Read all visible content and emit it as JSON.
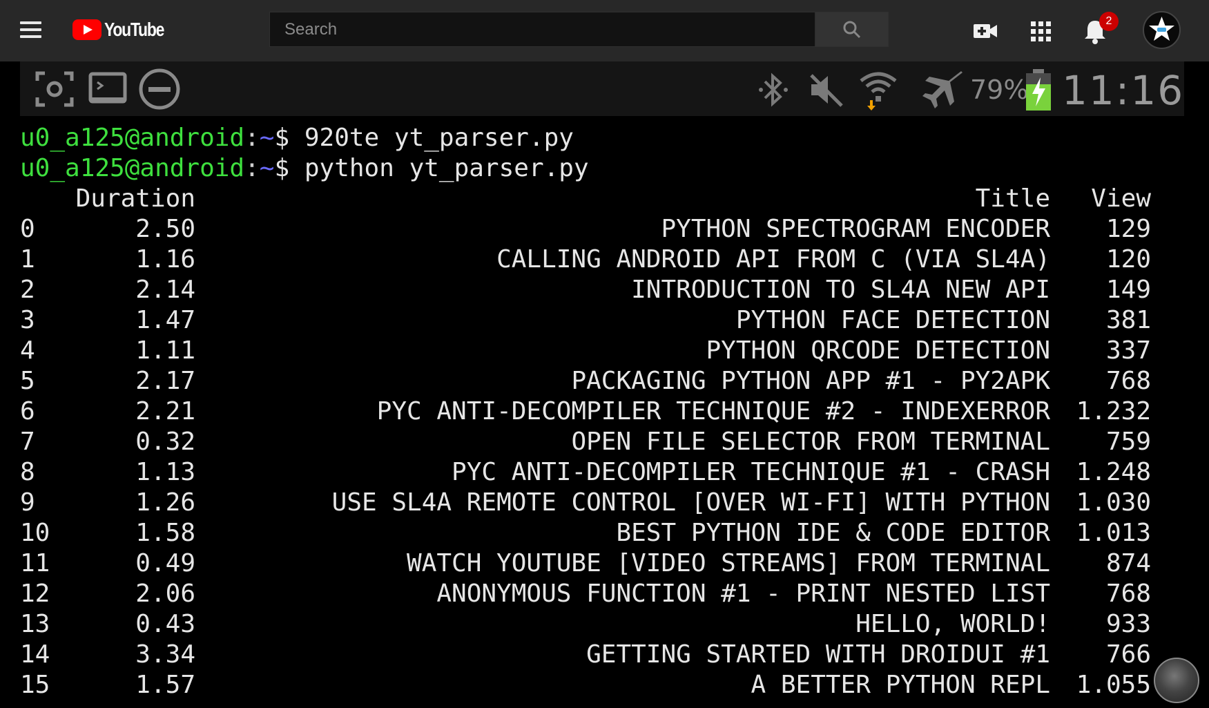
{
  "header": {
    "logo_text": "YouTube",
    "search_placeholder": "Search",
    "notification_count": "2"
  },
  "status_bar": {
    "battery_percent": "79%",
    "time": "11:16"
  },
  "terminal": {
    "prompts": [
      {
        "user": "u0_a125@android",
        "sep": ":",
        "path": "~",
        "symbol": "$",
        "command": " 920te yt_parser.py"
      },
      {
        "user": "u0_a125@android",
        "sep": ":",
        "path": "~",
        "symbol": "$",
        "command": " python yt_parser.py"
      }
    ],
    "columns": {
      "duration": "Duration",
      "title": "Title",
      "view": "View"
    },
    "rows": [
      {
        "index": "0",
        "duration": "2.50",
        "title": "PYTHON SPECTROGRAM ENCODER",
        "view": "129"
      },
      {
        "index": "1",
        "duration": "1.16",
        "title": "CALLING ANDROID API FROM C (VIA SL4A)",
        "view": "120"
      },
      {
        "index": "2",
        "duration": "2.14",
        "title": "INTRODUCTION TO SL4A NEW API",
        "view": "149"
      },
      {
        "index": "3",
        "duration": "1.47",
        "title": "PYTHON FACE DETECTION",
        "view": "381"
      },
      {
        "index": "4",
        "duration": "1.11",
        "title": "PYTHON QRCODE DETECTION",
        "view": "337"
      },
      {
        "index": "5",
        "duration": "2.17",
        "title": "PACKAGING PYTHON APP #1 - PY2APK",
        "view": "768"
      },
      {
        "index": "6",
        "duration": "2.21",
        "title": "PYC ANTI-DECOMPILER TECHNIQUE #2 - INDEXERROR",
        "view": "1.232"
      },
      {
        "index": "7",
        "duration": "0.32",
        "title": "OPEN FILE SELECTOR FROM TERMINAL",
        "view": "759"
      },
      {
        "index": "8",
        "duration": "1.13",
        "title": "PYC ANTI-DECOMPILER TECHNIQUE #1 - CRASH",
        "view": "1.248"
      },
      {
        "index": "9",
        "duration": "1.26",
        "title": "USE SL4A REMOTE CONTROL [OVER WI-FI] WITH PYTHON",
        "view": "1.030"
      },
      {
        "index": "10",
        "duration": "1.58",
        "title": "BEST PYTHON IDE & CODE EDITOR",
        "view": "1.013"
      },
      {
        "index": "11",
        "duration": "0.49",
        "title": "WATCH YOUTUBE [VIDEO STREAMS] FROM TERMINAL",
        "view": "874"
      },
      {
        "index": "12",
        "duration": "2.06",
        "title": "ANONYMOUS FUNCTION #1 - PRINT NESTED LIST",
        "view": "768"
      },
      {
        "index": "13",
        "duration": "0.43",
        "title": "HELLO, WORLD!",
        "view": "933"
      },
      {
        "index": "14",
        "duration": "3.34",
        "title": "GETTING STARTED WITH DROIDUI #1",
        "view": "766"
      },
      {
        "index": "15",
        "duration": "1.57",
        "title": "A BETTER PYTHON REPL",
        "view": "1.055"
      }
    ]
  }
}
